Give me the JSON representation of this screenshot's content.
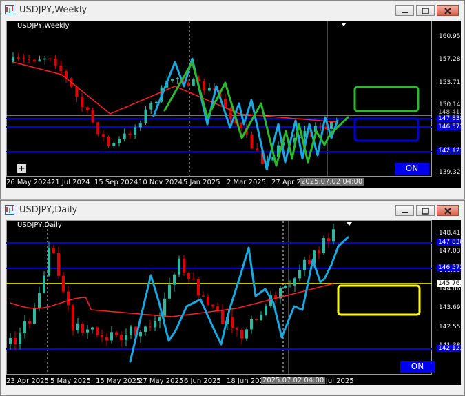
{
  "windows": {
    "top": {
      "title": "USDJPY,Weekly",
      "symbol_label": "USDJPY,Weekly",
      "on_label": "ON",
      "crosshair_time": "2025.07.02 04:00",
      "price_labels": [
        "160.955",
        "157.280",
        "153.710",
        "150.140",
        "146.570",
        "143.000",
        "139.325"
      ],
      "line_tags": [
        "148.413",
        "147.838",
        "146.572",
        "142.123"
      ],
      "x_labels": [
        "26 May 2024",
        "21 Jul 2024",
        "15 Sep 2024",
        "10 Nov 2024",
        "5 Jan 2025",
        "2 Mar 2025",
        "27 Apr 2025"
      ],
      "rect_colors": [
        "#2eb82e",
        "#1f6fb5"
      ]
    },
    "bottom": {
      "title": "USDJPY,Daily",
      "symbol_label": "USDJPY,Daily",
      "on_label": "ON",
      "crosshair_time": "2025.07.02 04:00",
      "price_labels": [
        "148.413",
        "147.030",
        "146.000",
        "144.860",
        "143.690",
        "142.550",
        "141.380"
      ],
      "line_tags": [
        "147.838",
        "146.572",
        "145.761",
        "142.123"
      ],
      "x_labels": [
        "23 Apr 2025",
        "5 May 2025",
        "15 May 2025",
        "27 May 2025",
        "6 Jun 2025",
        "18 Jun 2025",
        "10 Jul 2025"
      ],
      "rect_colors": [
        "#ffff00"
      ]
    }
  },
  "colors": {
    "bull": "#2eb8a0",
    "bear": "#e00000",
    "ma": "#ff2020",
    "level": "#0000d8",
    "yellow_level": "#ffff00",
    "drawing": "#1aa8e0",
    "drawing_green": "#2eb82e"
  },
  "icons": {
    "window": "chart-window-icon",
    "minimize": "minimize-icon",
    "maximize": "maximize-icon",
    "close": "close-icon"
  }
}
